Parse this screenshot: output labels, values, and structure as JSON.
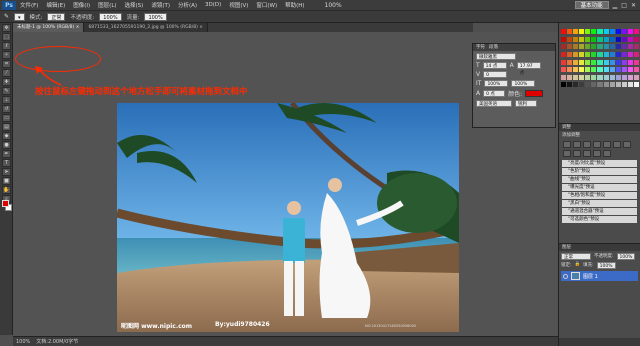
{
  "menubar": {
    "logo": "Ps",
    "items": [
      "文件(F)",
      "编辑(E)",
      "图像(I)",
      "图层(L)",
      "选择(S)",
      "滤镜(T)",
      "分析(A)",
      "3D(D)",
      "视图(V)",
      "窗口(W)",
      "帮助(H)"
    ],
    "zoom": "100%",
    "essentials": "基本功能"
  },
  "optbar": {
    "mode_label": "模式:",
    "mode_value": "正常",
    "opacity_label": "不透明度:",
    "opacity_value": "100%",
    "flow_label": "流量:",
    "flow_value": "100%"
  },
  "tabs": [
    {
      "label": "未标题-1 @ 100% (RGB/8) ×",
      "active": true
    },
    {
      "label": "6871533_162705591190_2.jpg @ 100% (RGB/8) ×",
      "active": false
    }
  ],
  "instruction": "按住鼠标左键拖动到这个地方松手即可将素材拖到文档中",
  "photo": {
    "watermark_left": "昵图网 www.nipic.com",
    "watermark_author": "By:yudi9780426",
    "watermark_id": "NO:20130417160550056000"
  },
  "statusbar": {
    "zoom": "100%",
    "doc": "文档:2.00M/0字节"
  },
  "char_panel": {
    "tabs": [
      "字符",
      "段落"
    ],
    "font": "微软雅黑",
    "size": "14 点",
    "leading": "17.97 点",
    "tracking": "0",
    "scale": "100%",
    "vscale": "100%",
    "baseline": "0 点",
    "color_label": "颜色:",
    "lang": "美国英语",
    "aa": "锐利"
  },
  "adjust_panel": {
    "title": "调整",
    "subtitle": "添加调整",
    "presets": [
      "\"亮度/对比度\"预设",
      "\"色阶\"预设",
      "\"曲线\"预设",
      "\"曝光度\"预设",
      "\"色相/饱和度\"预设",
      "\"黑白\"预设",
      "\"通道混合器\"预设",
      "\"可选颜色\"预设"
    ]
  },
  "layers_panel": {
    "title": "图层",
    "mode": "正常",
    "opacity_label": "不透明度:",
    "opacity": "100%",
    "lock_label": "锁定:",
    "fill_label": "填充:",
    "fill": "100%",
    "layer_name": "图层 1"
  },
  "colors": {
    "accent_red": "#ff2a00",
    "fg_color": "#e00000",
    "bg_color": "#ffffff",
    "selected_layer": "#3b6bc6"
  }
}
